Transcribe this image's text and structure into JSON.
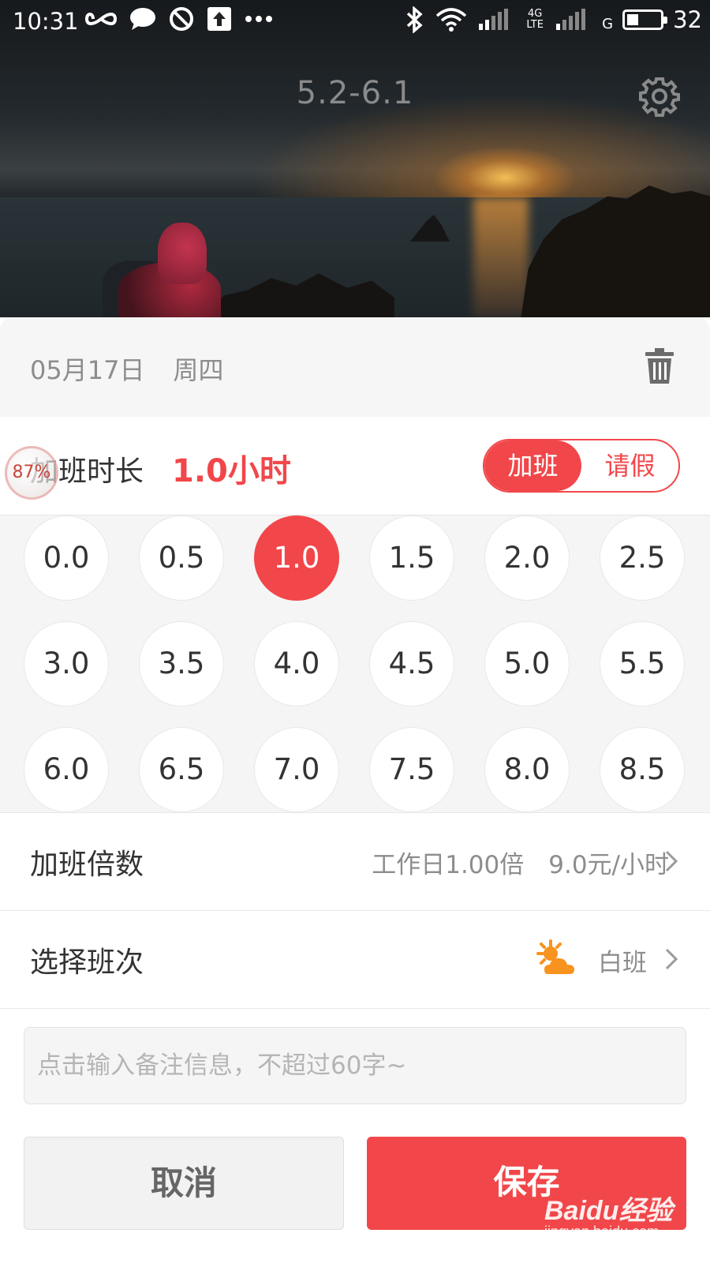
{
  "status_bar": {
    "time": "10:31",
    "battery": "32",
    "network_label": "4G LTE",
    "network_g": "G"
  },
  "header": {
    "period": "5.2-6.1",
    "settings_icon": "gear-icon"
  },
  "date_row": {
    "date": "05月17日",
    "weekday": "周四",
    "delete_icon": "trash-icon"
  },
  "duration": {
    "label": "加班时长",
    "value": "1.0小时",
    "toggle": {
      "left": "加班",
      "right": "请假",
      "active": "加班"
    },
    "floating_badge": "87%"
  },
  "hours": {
    "selected": "1.0",
    "options": [
      "0.0",
      "0.5",
      "1.0",
      "1.5",
      "2.0",
      "2.5",
      "3.0",
      "3.5",
      "4.0",
      "4.5",
      "5.0",
      "5.5",
      "6.0",
      "6.5",
      "7.0",
      "7.5",
      "8.0",
      "8.5"
    ]
  },
  "multiplier_row": {
    "label": "加班倍数",
    "value": "工作日1.00倍　9.0元/小时"
  },
  "shift_row": {
    "label": "选择班次",
    "value": "白班",
    "icon": "sun-cloud-icon"
  },
  "note": {
    "placeholder": "点击输入备注信息，不超过60字~",
    "value": ""
  },
  "actions": {
    "cancel": "取消",
    "save": "保存"
  },
  "watermark": {
    "main": "Baidu经验",
    "sub": "jingyan.baidu.com"
  },
  "colors": {
    "accent": "#f1474a",
    "muted_text": "#8d8d8d"
  }
}
